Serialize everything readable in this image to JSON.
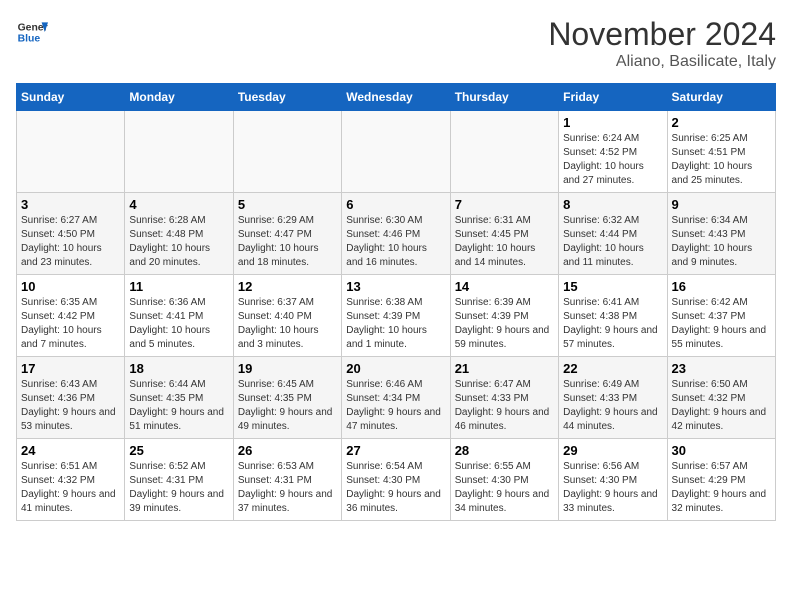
{
  "header": {
    "logo_line1": "General",
    "logo_line2": "Blue",
    "month_title": "November 2024",
    "subtitle": "Aliano, Basilicate, Italy"
  },
  "days_of_week": [
    "Sunday",
    "Monday",
    "Tuesday",
    "Wednesday",
    "Thursday",
    "Friday",
    "Saturday"
  ],
  "weeks": [
    [
      {
        "num": "",
        "info": ""
      },
      {
        "num": "",
        "info": ""
      },
      {
        "num": "",
        "info": ""
      },
      {
        "num": "",
        "info": ""
      },
      {
        "num": "",
        "info": ""
      },
      {
        "num": "1",
        "info": "Sunrise: 6:24 AM\nSunset: 4:52 PM\nDaylight: 10 hours and 27 minutes."
      },
      {
        "num": "2",
        "info": "Sunrise: 6:25 AM\nSunset: 4:51 PM\nDaylight: 10 hours and 25 minutes."
      }
    ],
    [
      {
        "num": "3",
        "info": "Sunrise: 6:27 AM\nSunset: 4:50 PM\nDaylight: 10 hours and 23 minutes."
      },
      {
        "num": "4",
        "info": "Sunrise: 6:28 AM\nSunset: 4:48 PM\nDaylight: 10 hours and 20 minutes."
      },
      {
        "num": "5",
        "info": "Sunrise: 6:29 AM\nSunset: 4:47 PM\nDaylight: 10 hours and 18 minutes."
      },
      {
        "num": "6",
        "info": "Sunrise: 6:30 AM\nSunset: 4:46 PM\nDaylight: 10 hours and 16 minutes."
      },
      {
        "num": "7",
        "info": "Sunrise: 6:31 AM\nSunset: 4:45 PM\nDaylight: 10 hours and 14 minutes."
      },
      {
        "num": "8",
        "info": "Sunrise: 6:32 AM\nSunset: 4:44 PM\nDaylight: 10 hours and 11 minutes."
      },
      {
        "num": "9",
        "info": "Sunrise: 6:34 AM\nSunset: 4:43 PM\nDaylight: 10 hours and 9 minutes."
      }
    ],
    [
      {
        "num": "10",
        "info": "Sunrise: 6:35 AM\nSunset: 4:42 PM\nDaylight: 10 hours and 7 minutes."
      },
      {
        "num": "11",
        "info": "Sunrise: 6:36 AM\nSunset: 4:41 PM\nDaylight: 10 hours and 5 minutes."
      },
      {
        "num": "12",
        "info": "Sunrise: 6:37 AM\nSunset: 4:40 PM\nDaylight: 10 hours and 3 minutes."
      },
      {
        "num": "13",
        "info": "Sunrise: 6:38 AM\nSunset: 4:39 PM\nDaylight: 10 hours and 1 minute."
      },
      {
        "num": "14",
        "info": "Sunrise: 6:39 AM\nSunset: 4:39 PM\nDaylight: 9 hours and 59 minutes."
      },
      {
        "num": "15",
        "info": "Sunrise: 6:41 AM\nSunset: 4:38 PM\nDaylight: 9 hours and 57 minutes."
      },
      {
        "num": "16",
        "info": "Sunrise: 6:42 AM\nSunset: 4:37 PM\nDaylight: 9 hours and 55 minutes."
      }
    ],
    [
      {
        "num": "17",
        "info": "Sunrise: 6:43 AM\nSunset: 4:36 PM\nDaylight: 9 hours and 53 minutes."
      },
      {
        "num": "18",
        "info": "Sunrise: 6:44 AM\nSunset: 4:35 PM\nDaylight: 9 hours and 51 minutes."
      },
      {
        "num": "19",
        "info": "Sunrise: 6:45 AM\nSunset: 4:35 PM\nDaylight: 9 hours and 49 minutes."
      },
      {
        "num": "20",
        "info": "Sunrise: 6:46 AM\nSunset: 4:34 PM\nDaylight: 9 hours and 47 minutes."
      },
      {
        "num": "21",
        "info": "Sunrise: 6:47 AM\nSunset: 4:33 PM\nDaylight: 9 hours and 46 minutes."
      },
      {
        "num": "22",
        "info": "Sunrise: 6:49 AM\nSunset: 4:33 PM\nDaylight: 9 hours and 44 minutes."
      },
      {
        "num": "23",
        "info": "Sunrise: 6:50 AM\nSunset: 4:32 PM\nDaylight: 9 hours and 42 minutes."
      }
    ],
    [
      {
        "num": "24",
        "info": "Sunrise: 6:51 AM\nSunset: 4:32 PM\nDaylight: 9 hours and 41 minutes."
      },
      {
        "num": "25",
        "info": "Sunrise: 6:52 AM\nSunset: 4:31 PM\nDaylight: 9 hours and 39 minutes."
      },
      {
        "num": "26",
        "info": "Sunrise: 6:53 AM\nSunset: 4:31 PM\nDaylight: 9 hours and 37 minutes."
      },
      {
        "num": "27",
        "info": "Sunrise: 6:54 AM\nSunset: 4:30 PM\nDaylight: 9 hours and 36 minutes."
      },
      {
        "num": "28",
        "info": "Sunrise: 6:55 AM\nSunset: 4:30 PM\nDaylight: 9 hours and 34 minutes."
      },
      {
        "num": "29",
        "info": "Sunrise: 6:56 AM\nSunset: 4:30 PM\nDaylight: 9 hours and 33 minutes."
      },
      {
        "num": "30",
        "info": "Sunrise: 6:57 AM\nSunset: 4:29 PM\nDaylight: 9 hours and 32 minutes."
      }
    ]
  ]
}
